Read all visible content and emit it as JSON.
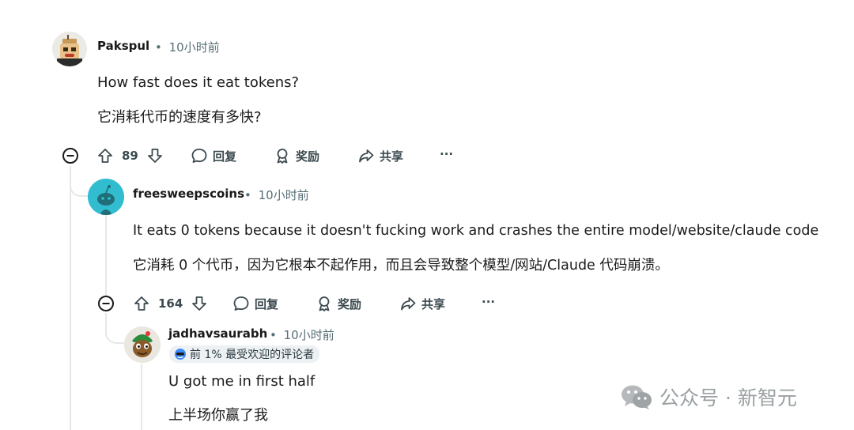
{
  "comments": [
    {
      "username": "Pakspul",
      "time": "10小时前",
      "text_en": "How fast does it eat tokens?",
      "text_zh": "它消耗代币的速度有多快?",
      "votes": "89",
      "reply": "回复",
      "award": "奖励",
      "share": "共享",
      "more": "···"
    },
    {
      "username": "freesweepscoins",
      "time": "10小时前",
      "text_en": "It eats 0 tokens because it doesn't fucking work and crashes the entire model/website/claude code",
      "text_zh": "它消耗 0 个代币，因为它根本不起作用，而且会导致整个模型/网站/Claude 代码崩溃。",
      "votes": "164",
      "reply": "回复",
      "award": "奖励",
      "share": "共享",
      "more": "···"
    },
    {
      "username": "jadhavsaurabh",
      "time": "10小时前",
      "flair": "前 1% 最受欢迎的评论者",
      "text_en": "U got me in first half",
      "text_zh": "上半场你赢了我"
    }
  ],
  "separator": "•",
  "watermark": "公众号 · 新智元",
  "colors": {
    "background": "#ffffff",
    "text": "#1a1a1b",
    "meta": "#576f76",
    "thread": "#e5e7e9",
    "avatar_teal": "#32bcd0"
  }
}
